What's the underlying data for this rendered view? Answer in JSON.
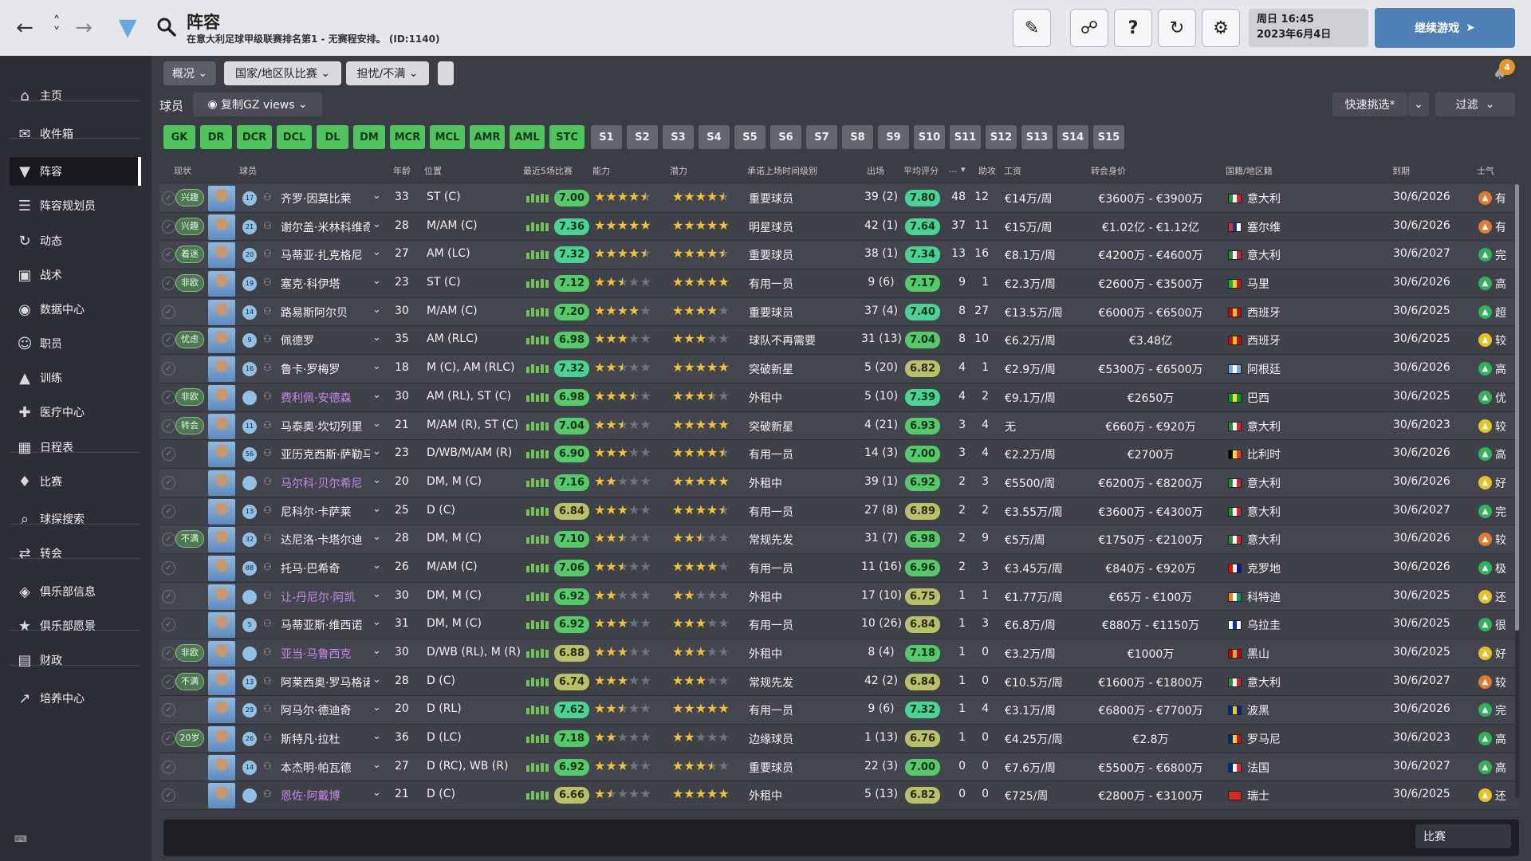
{
  "header": {
    "title": "阵容",
    "subtitle": "在意大利足球甲级联赛排名第1 - 无赛程安排。 (ID:1140)",
    "date_line1": "周日 16:45",
    "date_line2": "2023年6月4日",
    "continue_label": "继续游戏"
  },
  "sidebar": {
    "items": [
      {
        "label": "主页",
        "icon": "home-icon"
      },
      {
        "label": "收件箱",
        "icon": "inbox-icon"
      },
      {
        "label": "阵容",
        "icon": "shirt-icon"
      },
      {
        "label": "阵容规划员",
        "icon": "clipboard-icon"
      },
      {
        "label": "动态",
        "icon": "dynamics-icon"
      },
      {
        "label": "战术",
        "icon": "tactics-icon"
      },
      {
        "label": "数据中心",
        "icon": "data-icon"
      },
      {
        "label": "职员",
        "icon": "staff-icon"
      },
      {
        "label": "训练",
        "icon": "training-icon"
      },
      {
        "label": "医疗中心",
        "icon": "medical-icon"
      },
      {
        "label": "日程表",
        "icon": "calendar-icon"
      },
      {
        "label": "比赛",
        "icon": "trophy-icon"
      },
      {
        "label": "球探搜索",
        "icon": "scout-icon"
      },
      {
        "label": "转会",
        "icon": "transfer-icon"
      },
      {
        "label": "俱乐部信息",
        "icon": "shield-icon"
      },
      {
        "label": "俱乐部愿景",
        "icon": "vision-icon"
      },
      {
        "label": "财政",
        "icon": "finance-icon"
      },
      {
        "label": "培养中心",
        "icon": "development-icon"
      }
    ]
  },
  "toolbar": {
    "overview": "概况",
    "national": "国家/地区队比赛",
    "concerns": "担忧/不满",
    "players": "球员",
    "views": "复制GZ views",
    "quick_pick": "快速挑选*",
    "filter": "过滤",
    "notifications": "4"
  },
  "positions": [
    "GK",
    "DR",
    "DCR",
    "DCL",
    "DL",
    "DM",
    "MCR",
    "MCL",
    "AMR",
    "AML",
    "STC"
  ],
  "slots": [
    "S1",
    "S2",
    "S3",
    "S4",
    "S5",
    "S6",
    "S7",
    "S8",
    "S9",
    "S10",
    "S11",
    "S12",
    "S13",
    "S14",
    "S15"
  ],
  "columns": {
    "status": "现状",
    "player": "球员",
    "age": "年龄",
    "position": "位置",
    "last5": "最近5场比赛",
    "ability": "能力",
    "potential": "潜力",
    "playing_time": "承诺上场时间级别",
    "apps": "出场",
    "avg_rating": "平均评分",
    "dots": "...",
    "assists": "助攻",
    "wage": "工资",
    "value": "转会身价",
    "nation": "国籍/地区籍",
    "expires": "到期",
    "morale": "士气"
  },
  "players": [
    {
      "tag": "兴趣",
      "no": "17",
      "name": "齐罗·因莫比莱",
      "age": "33",
      "pos": "ST (C)",
      "form": "7.00",
      "ab": 4.5,
      "pot": 4.5,
      "role": "重要球员",
      "apps": "39 (2)",
      "avg": "7.80",
      "gls": "48",
      "ast": "12",
      "wage": "€14万/周",
      "value": "€3600万 - €3900万",
      "nation": "意大利",
      "exp": "30/6/2026",
      "morale": "有",
      "mc": "#e07a2f",
      "flag": [
        "#2e8b3a",
        "#fff",
        "#d23"
      ],
      "loan": false
    },
    {
      "tag": "兴趣",
      "no": "21",
      "name": "谢尔盖·米林科维奇-萨维奇",
      "age": "28",
      "pos": "M/AM (C)",
      "form": "7.36",
      "ab": 5,
      "pot": 5,
      "role": "明星球员",
      "apps": "42 (1)",
      "avg": "7.64",
      "gls": "37",
      "ast": "11",
      "wage": "€15万/周",
      "value": "€1.02亿 - €1.12亿",
      "nation": "塞尔维",
      "exp": "30/6/2026",
      "morale": "有",
      "mc": "#e07a2f",
      "flag": [
        "#c6363c",
        "#0c4076",
        "#fff"
      ],
      "loan": false
    },
    {
      "tag": "着迷",
      "no": "20",
      "name": "马蒂亚·扎克格尼",
      "age": "27",
      "pos": "AM (LC)",
      "form": "7.32",
      "ab": 4.5,
      "pot": 4.5,
      "role": "重要球员",
      "apps": "38 (1)",
      "avg": "7.34",
      "gls": "13",
      "ast": "16",
      "wage": "€8.1万/周",
      "value": "€4200万 - €4600万",
      "nation": "意大利",
      "exp": "30/6/2027",
      "morale": "完",
      "mc": "#2fb35a",
      "flag": [
        "#2e8b3a",
        "#fff",
        "#d23"
      ],
      "loan": false
    },
    {
      "tag": "非欧",
      "no": "19",
      "name": "塞克·科伊塔",
      "age": "23",
      "pos": "ST (C)",
      "form": "7.12",
      "ab": 2.5,
      "pot": 5,
      "role": "有用一员",
      "apps": "9 (6)",
      "avg": "7.17",
      "gls": "9",
      "ast": "1",
      "wage": "€2.3万/周",
      "value": "€2600万 - €3500万",
      "nation": "马里",
      "exp": "30/6/2026",
      "morale": "高",
      "mc": "#2fb35a",
      "flag": [
        "#14b53a",
        "#fcd116",
        "#ce1126"
      ],
      "loan": false
    },
    {
      "tag": "",
      "no": "14",
      "name": "路易斯阿尔贝",
      "age": "30",
      "pos": "M/AM (C)",
      "form": "7.20",
      "ab": 4,
      "pot": 4,
      "role": "重要球员",
      "apps": "37 (4)",
      "avg": "7.40",
      "gls": "8",
      "ast": "27",
      "wage": "€13.5万/周",
      "value": "€6000万 - €6500万",
      "nation": "西班牙",
      "exp": "30/6/2025",
      "morale": "超",
      "mc": "#2fb35a",
      "flag": [
        "#c60b1e",
        "#ffc400",
        "#c60b1e"
      ],
      "loan": false
    },
    {
      "tag": "忧虑",
      "no": "9",
      "name": "佩德罗",
      "age": "35",
      "pos": "AM (RLC)",
      "form": "6.98",
      "ab": 3,
      "pot": 3,
      "role": "球队不再需要",
      "apps": "31 (13)",
      "avg": "7.04",
      "gls": "8",
      "ast": "10",
      "wage": "€6.2万/周",
      "value": "€3.48亿",
      "nation": "西班牙",
      "exp": "30/6/2025",
      "morale": "较",
      "mc": "#e5c21f",
      "flag": [
        "#c60b1e",
        "#ffc400",
        "#c60b1e"
      ],
      "loan": false
    },
    {
      "tag": "",
      "no": "16",
      "name": "鲁卡·罗梅罗",
      "age": "18",
      "pos": "M (C), AM (RLC)",
      "form": "7.32",
      "ab": 2.5,
      "pot": 5,
      "role": "突破新星",
      "apps": "5 (20)",
      "avg": "6.82",
      "gls": "4",
      "ast": "1",
      "wage": "€2.9万/周",
      "value": "€5300万 - €6500万",
      "nation": "阿根廷",
      "exp": "30/6/2026",
      "morale": "高",
      "mc": "#2fb35a",
      "flag": [
        "#74acdf",
        "#fff",
        "#74acdf"
      ],
      "loan": false
    },
    {
      "tag": "非欧",
      "no": "",
      "name": "费利佩·安德森",
      "age": "30",
      "pos": "AM (RL), ST (C)",
      "form": "6.98",
      "ab": 3.5,
      "pot": 3.5,
      "role": "外租中",
      "apps": "5 (10)",
      "avg": "7.39",
      "gls": "4",
      "ast": "2",
      "wage": "€9.1万/周",
      "value": "€2650万",
      "nation": "巴西",
      "exp": "30/6/2025",
      "morale": "优",
      "mc": "#2fb35a",
      "flag": [
        "#009c3b",
        "#ffdf00",
        "#009c3b"
      ],
      "loan": true
    },
    {
      "tag": "转会",
      "no": "11",
      "name": "马泰奥·坎切列里",
      "age": "21",
      "pos": "M/AM (R), ST (C)",
      "form": "7.04",
      "ab": 2.5,
      "pot": 5,
      "role": "突破新星",
      "apps": "4 (21)",
      "avg": "6.93",
      "gls": "3",
      "ast": "4",
      "wage": "无",
      "value": "€660万 - €920万",
      "nation": "意大利",
      "exp": "30/6/2023",
      "morale": "较",
      "mc": "#e5c21f",
      "flag": [
        "#2e8b3a",
        "#fff",
        "#d23"
      ],
      "loan": false
    },
    {
      "tag": "",
      "no": "56",
      "name": "亚历克西斯·萨勒马克尔斯",
      "age": "23",
      "pos": "D/WB/M/AM (R)",
      "form": "6.90",
      "ab": 3,
      "pot": 4.5,
      "role": "有用一员",
      "apps": "14 (3)",
      "avg": "7.00",
      "gls": "3",
      "ast": "4",
      "wage": "€2.2万/周",
      "value": "€2700万",
      "nation": "比利时",
      "exp": "30/6/2026",
      "morale": "高",
      "mc": "#2fb35a",
      "flag": [
        "#000",
        "#fdda24",
        "#ef3340"
      ],
      "loan": false
    },
    {
      "tag": "",
      "no": "",
      "name": "马尔科·贝尔希尼",
      "age": "20",
      "pos": "DM, M (C)",
      "form": "7.16",
      "ab": 2,
      "pot": 5,
      "role": "外租中",
      "apps": "39 (1)",
      "avg": "6.92",
      "gls": "2",
      "ast": "3",
      "wage": "€5500/周",
      "value": "€6200万 - €8200万",
      "nation": "意大利",
      "exp": "30/6/2026",
      "morale": "好",
      "mc": "#e5c21f",
      "flag": [
        "#2e8b3a",
        "#fff",
        "#d23"
      ],
      "loan": true
    },
    {
      "tag": "",
      "no": "13",
      "name": "尼科尔·卡萨莱",
      "age": "25",
      "pos": "D (C)",
      "form": "6.84",
      "ab": 3,
      "pot": 4.5,
      "role": "有用一员",
      "apps": "27 (8)",
      "avg": "6.89",
      "gls": "2",
      "ast": "2",
      "wage": "€3.55万/周",
      "value": "€3600万 - €4300万",
      "nation": "意大利",
      "exp": "30/6/2027",
      "morale": "完",
      "mc": "#2fb35a",
      "flag": [
        "#2e8b3a",
        "#fff",
        "#d23"
      ],
      "loan": false
    },
    {
      "tag": "不满",
      "no": "32",
      "name": "达尼洛·卡塔尔迪",
      "age": "28",
      "pos": "DM, M (C)",
      "form": "7.10",
      "ab": 2.5,
      "pot": 2.5,
      "role": "常规先发",
      "apps": "31 (7)",
      "avg": "6.98",
      "gls": "2",
      "ast": "9",
      "wage": "€5万/周",
      "value": "€1750万 - €2100万",
      "nation": "意大利",
      "exp": "30/6/2026",
      "morale": "较",
      "mc": "#e07a2f",
      "flag": [
        "#2e8b3a",
        "#fff",
        "#d23"
      ],
      "loan": false
    },
    {
      "tag": "",
      "no": "88",
      "name": "托马·巴希奇",
      "age": "26",
      "pos": "M/AM (C)",
      "form": "7.06",
      "ab": 2.5,
      "pot": 4,
      "role": "有用一员",
      "apps": "11 (16)",
      "avg": "6.96",
      "gls": "2",
      "ast": "3",
      "wage": "€3.45万/周",
      "value": "€840万 - €920万",
      "nation": "克罗地",
      "exp": "30/6/2026",
      "morale": "极",
      "mc": "#2fb35a",
      "flag": [
        "#ff0000",
        "#fff",
        "#171796"
      ],
      "loan": false
    },
    {
      "tag": "",
      "no": "",
      "name": "让-丹尼尔·阿凯",
      "age": "30",
      "pos": "DM, M (C)",
      "form": "6.92",
      "ab": 2,
      "pot": 2,
      "role": "外租中",
      "apps": "17 (10)",
      "avg": "6.75",
      "gls": "1",
      "ast": "1",
      "wage": "€1.77万/周",
      "value": "€65万 - €100万",
      "nation": "科特迪",
      "exp": "30/6/2025",
      "morale": "还",
      "mc": "#e5c21f",
      "flag": [
        "#f77f00",
        "#fff",
        "#009e60"
      ],
      "loan": true
    },
    {
      "tag": "",
      "no": "5",
      "name": "马蒂亚斯·维西诺",
      "age": "31",
      "pos": "DM, M (C)",
      "form": "6.92",
      "ab": 3,
      "pot": 3,
      "role": "有用一员",
      "apps": "10 (26)",
      "avg": "6.84",
      "gls": "1",
      "ast": "3",
      "wage": "€6.8万/周",
      "value": "€880万 - €1150万",
      "nation": "乌拉圭",
      "exp": "30/6/2025",
      "morale": "很",
      "mc": "#2fb35a",
      "flag": [
        "#fff",
        "#0038a8",
        "#fff"
      ],
      "loan": false
    },
    {
      "tag": "非欧",
      "no": "",
      "name": "亚当·马鲁西克",
      "age": "30",
      "pos": "D/WB (RL), M (R)",
      "form": "6.88",
      "ab": 3,
      "pot": 3,
      "role": "外租中",
      "apps": "8 (4)",
      "avg": "7.18",
      "gls": "1",
      "ast": "0",
      "wage": "€3.2万/周",
      "value": "€1000万",
      "nation": "黑山",
      "exp": "30/6/2025",
      "morale": "好",
      "mc": "#e5c21f",
      "flag": [
        "#c40308",
        "#d4af37",
        "#c40308"
      ],
      "loan": true
    },
    {
      "tag": "不满",
      "no": "13",
      "name": "阿莱西奥·罗马格诺里",
      "age": "28",
      "pos": "D (C)",
      "form": "6.74",
      "ab": 3,
      "pot": 3,
      "role": "常规先发",
      "apps": "42 (2)",
      "avg": "6.84",
      "gls": "1",
      "ast": "0",
      "wage": "€10.5万/周",
      "value": "€1600万 - €1800万",
      "nation": "意大利",
      "exp": "30/6/2027",
      "morale": "较",
      "mc": "#e07a2f",
      "flag": [
        "#2e8b3a",
        "#fff",
        "#d23"
      ],
      "loan": false
    },
    {
      "tag": "",
      "no": "29",
      "name": "阿马尔·德迪奇",
      "age": "20",
      "pos": "D (RL)",
      "form": "7.62",
      "ab": 2.5,
      "pot": 5,
      "role": "有用一员",
      "apps": "9 (6)",
      "avg": "7.32",
      "gls": "1",
      "ast": "4",
      "wage": "€3.1万/周",
      "value": "€6800万 - €7700万",
      "nation": "波黑",
      "exp": "30/6/2026",
      "morale": "完",
      "mc": "#2fb35a",
      "flag": [
        "#002395",
        "#fecb00",
        "#002395"
      ],
      "loan": false
    },
    {
      "tag": "20岁",
      "no": "26",
      "name": "斯特凡·拉杜",
      "age": "36",
      "pos": "D (LC)",
      "form": "7.18",
      "ab": 2,
      "pot": 2,
      "role": "边缘球员",
      "apps": "1 (13)",
      "avg": "6.76",
      "gls": "1",
      "ast": "0",
      "wage": "€4.25万/周",
      "value": "€2.8万",
      "nation": "罗马尼",
      "exp": "30/6/2023",
      "morale": "高",
      "mc": "#2fb35a",
      "flag": [
        "#002b7f",
        "#fcd116",
        "#ce1126"
      ],
      "loan": false
    },
    {
      "tag": "",
      "no": "14",
      "name": "本杰明·帕瓦德",
      "age": "27",
      "pos": "D (RC), WB (R)",
      "form": "6.92",
      "ab": 3,
      "pot": 3.5,
      "role": "重要球员",
      "apps": "22 (3)",
      "avg": "7.00",
      "gls": "0",
      "ast": "0",
      "wage": "€7.6万/周",
      "value": "€5500万 - €6800万",
      "nation": "法国",
      "exp": "30/6/2027",
      "morale": "高",
      "mc": "#2fb35a",
      "flag": [
        "#002395",
        "#fff",
        "#ed2939"
      ],
      "loan": false
    },
    {
      "tag": "",
      "no": "",
      "name": "恩佐·阿戴博",
      "age": "21",
      "pos": "D (C)",
      "form": "6.66",
      "ab": 1.5,
      "pot": 5,
      "role": "外租中",
      "apps": "5 (13)",
      "avg": "6.82",
      "gls": "0",
      "ast": "0",
      "wage": "€725/周",
      "value": "€2800万 - €3100万",
      "nation": "瑞士",
      "exp": "30/6/2025",
      "morale": "还",
      "mc": "#e5c21f",
      "flag": [
        "#d52b1e",
        "#d52b1e",
        "#d52b1e"
      ],
      "loan": true
    }
  ],
  "bottom": {
    "match_label": "比赛"
  }
}
